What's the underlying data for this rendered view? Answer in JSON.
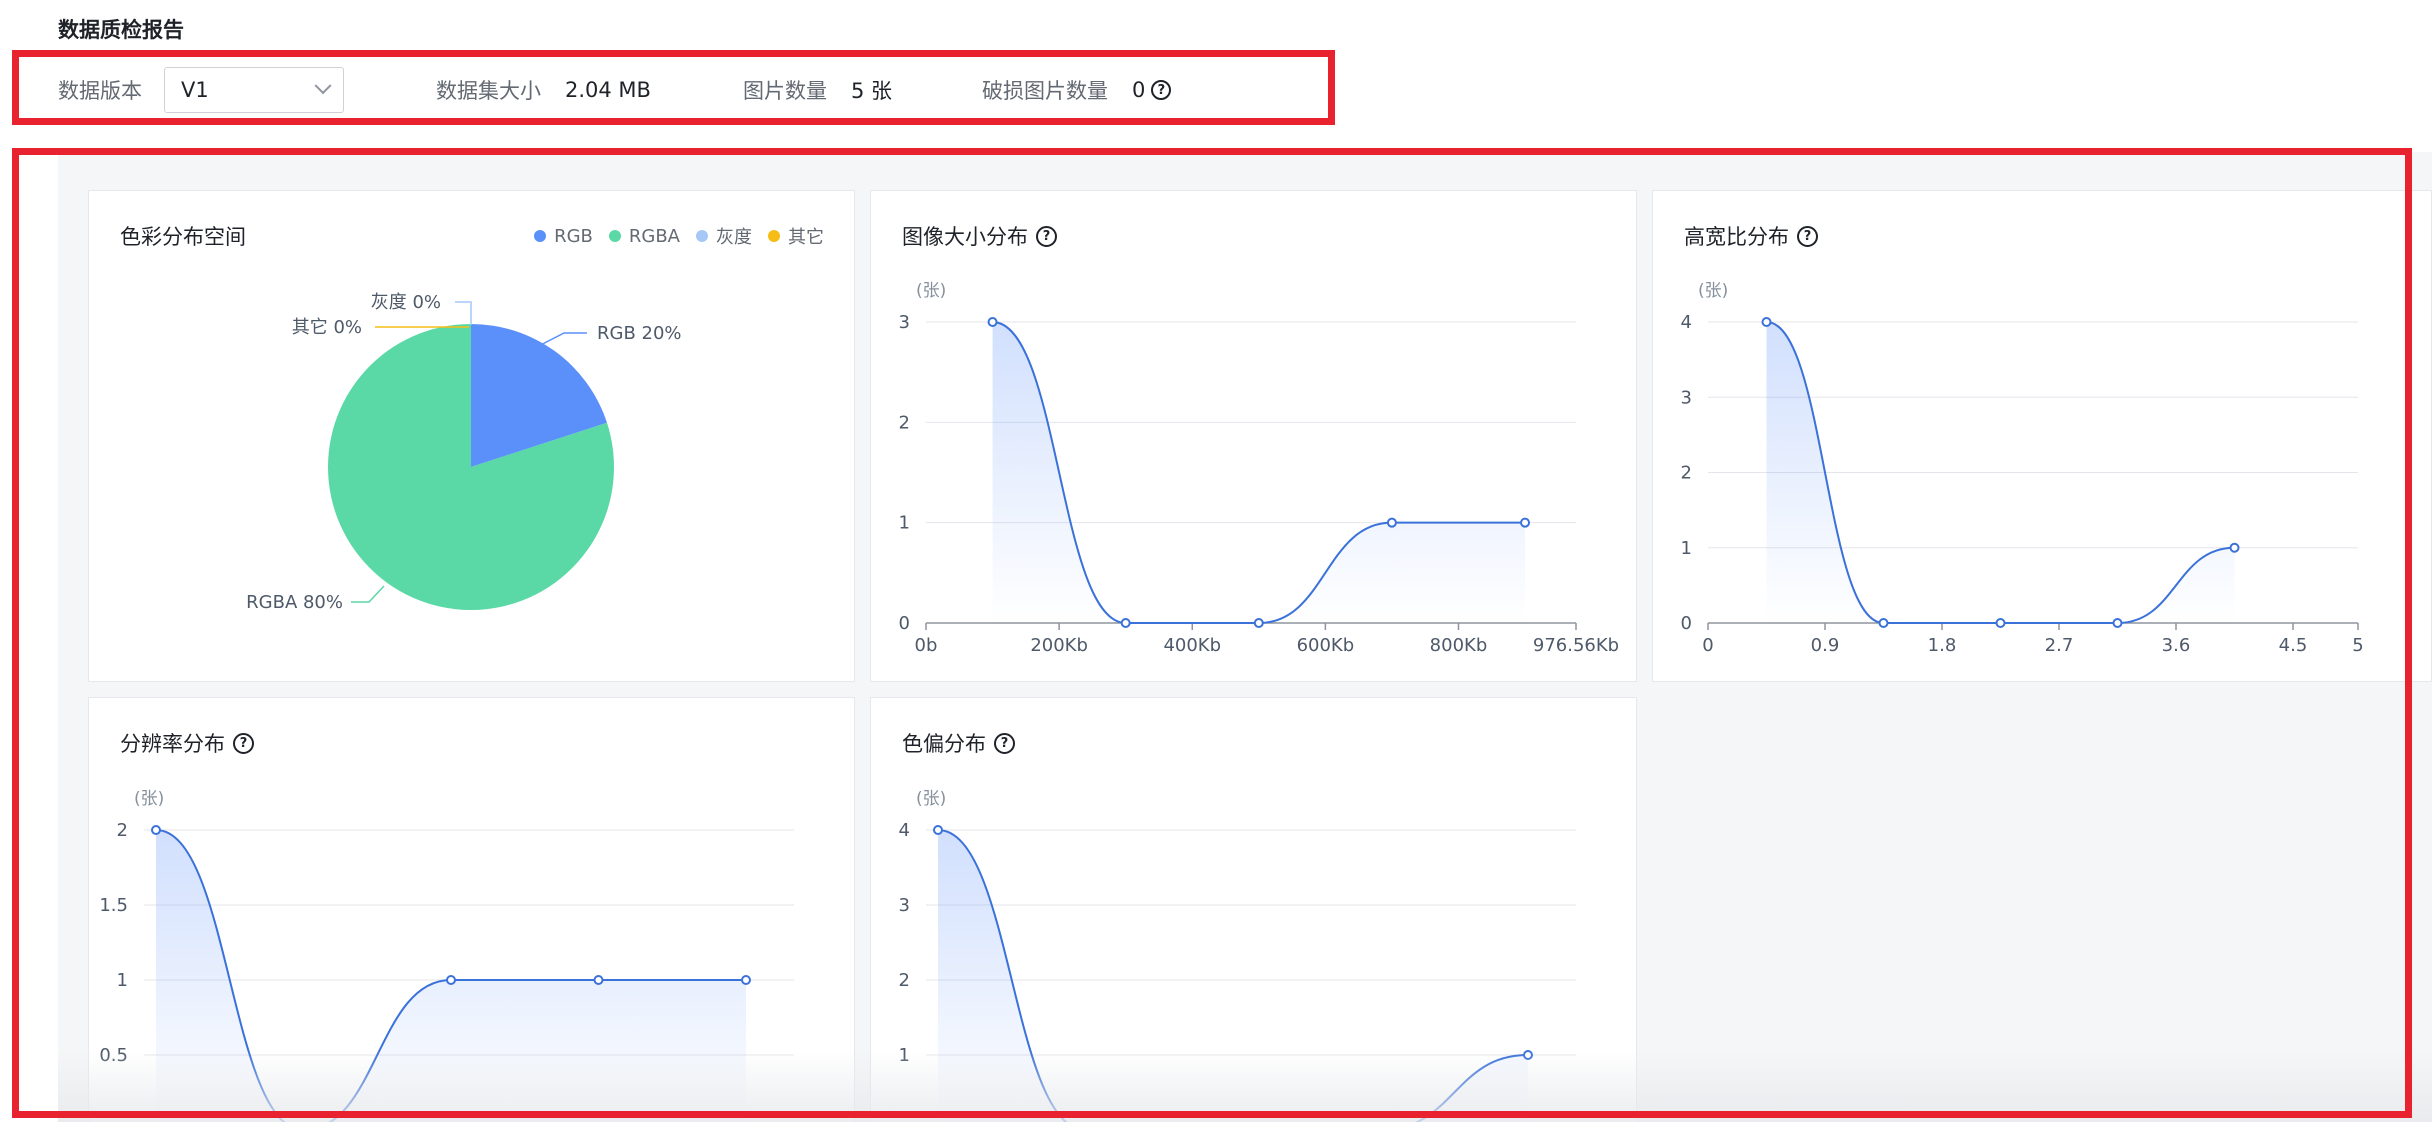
{
  "page": {
    "title": "数据质检报告"
  },
  "meta": {
    "version_label": "数据版本",
    "version_value": "V1",
    "dataset_size_label": "数据集大小",
    "dataset_size_value": "2.04 MB",
    "image_count_label": "图片数量",
    "image_count_value": "5 张",
    "broken_label": "破损图片数量",
    "broken_value": "0"
  },
  "colors": {
    "highlight_border": "#e8222e",
    "line": "#3b72d9",
    "rgb": "#5b8ff9",
    "rgba": "#5ad8a6",
    "gray": "#a6c8f7",
    "other": "#f6bd16"
  },
  "chart_data": [
    {
      "type": "pie",
      "title": "色彩分布空间",
      "legend": [
        "RGB",
        "RGBA",
        "灰度",
        "其它"
      ],
      "slices": [
        {
          "name": "RGB",
          "value": 20,
          "label": "RGB 20%"
        },
        {
          "name": "RGBA",
          "value": 80,
          "label": "RGBA 80%"
        },
        {
          "name": "灰度",
          "value": 0,
          "label": "灰度 0%"
        },
        {
          "name": "其它",
          "value": 0,
          "label": "其它 0%"
        }
      ],
      "legend_position": "top-right"
    },
    {
      "type": "area",
      "title": "图像大小分布",
      "unit_label": "(张)",
      "x_ticks": [
        "0b",
        "200Kb",
        "400Kb",
        "600Kb",
        "800Kb",
        "976.56Kb"
      ],
      "y_ticks": [
        "0",
        "1",
        "2",
        "3"
      ],
      "x": [
        100,
        300,
        500,
        700,
        900
      ],
      "y": [
        3,
        0,
        0,
        1,
        1
      ],
      "xlim": [
        0,
        976.56
      ],
      "ylim": [
        0,
        3
      ],
      "grid": true
    },
    {
      "type": "area",
      "title": "高宽比分布",
      "unit_label": "(张)",
      "x_ticks": [
        "0",
        "0.9",
        "1.8",
        "2.7",
        "3.6",
        "4.5",
        "5"
      ],
      "y_ticks": [
        "0",
        "1",
        "2",
        "3",
        "4"
      ],
      "x": [
        0.45,
        1.35,
        2.25,
        3.15,
        4.05
      ],
      "y": [
        4,
        0,
        0,
        0,
        1
      ],
      "xlim": [
        0,
        5
      ],
      "ylim": [
        0,
        4
      ],
      "grid": true
    },
    {
      "type": "area",
      "title": "分辨率分布",
      "unit_label": "(张)",
      "y_ticks": [
        "0.5",
        "1",
        "1.5",
        "2"
      ],
      "x": [
        0,
        1,
        2,
        3,
        4
      ],
      "y": [
        2,
        0,
        1,
        1,
        1
      ],
      "ylim": [
        0,
        2
      ],
      "grid": true
    },
    {
      "type": "area",
      "title": "色偏分布",
      "unit_label": "(张)",
      "y_ticks": [
        "1",
        "2",
        "3",
        "4"
      ],
      "x": [
        0,
        1,
        2,
        3,
        4
      ],
      "y": [
        4,
        0,
        0,
        0,
        1
      ],
      "ylim": [
        0,
        4
      ],
      "grid": true
    }
  ]
}
